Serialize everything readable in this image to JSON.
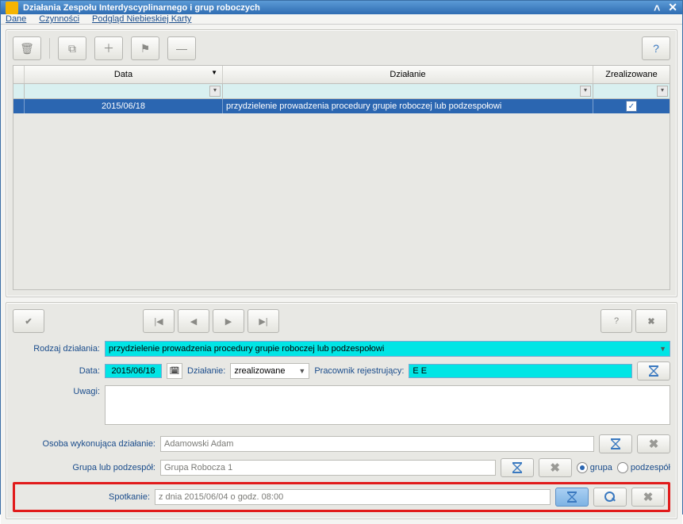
{
  "window": {
    "title": "Działania Zespołu Interdyscyplinarnego i grup roboczych"
  },
  "menu": {
    "dane": "Dane",
    "czynnosci": "Czynności",
    "podglad": "Podgląd Niebieskiej Karty"
  },
  "grid": {
    "headers": {
      "data": "Data",
      "action": "Działanie",
      "done": "Zrealizowane"
    },
    "row": {
      "date": "2015/06/18",
      "action": "przydzielenie prowadzenia procedury grupie roboczej lub podzespołowi",
      "done": true
    }
  },
  "form": {
    "labels": {
      "rodzaj": "Rodzaj działania:",
      "data": "Data:",
      "dzialanie": "Działanie:",
      "pracownik": "Pracownik rejestrujący:",
      "uwagi": "Uwagi:",
      "osoba": "Osoba wykonująca działanie:",
      "grupa": "Grupa lub podzespół:",
      "spotkanie": "Spotkanie:"
    },
    "values": {
      "rodzaj": "przydzielenie prowadzenia procedury grupie roboczej lub podzespołowi",
      "data": "2015/06/18",
      "dzialanie": "zrealizowane",
      "pracownik": "E E",
      "osoba": "Adamowski Adam",
      "grupa": "Grupa Robocza 1",
      "spotkanie": "z dnia 2015/06/04 o godz. 08:00"
    },
    "radio": {
      "grupa": "grupa",
      "podzespol": "podzespół",
      "selected": "grupa"
    }
  }
}
